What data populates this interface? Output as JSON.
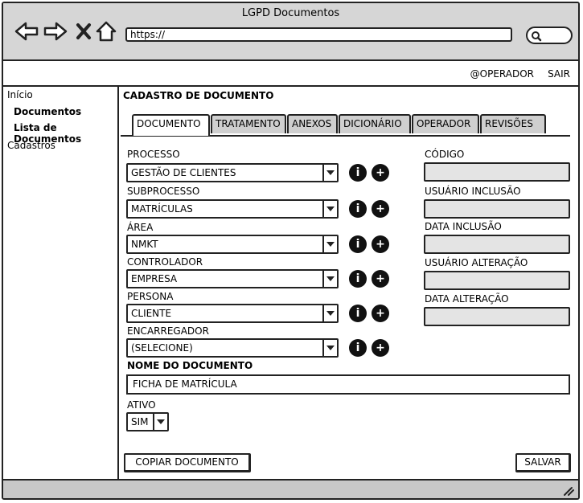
{
  "window": {
    "title": "LGPD Documentos"
  },
  "browser": {
    "url": "https://"
  },
  "userbar": {
    "operator": "@OPERADOR",
    "logout": "SAIR"
  },
  "sidebar": {
    "home": "Início",
    "documents": "Documentos",
    "document_list": "Lista de Documentos",
    "registers": "Cadastros"
  },
  "form": {
    "title": "CADASTRO DE DOCUMENTO",
    "tabs": [
      "DOCUMENTO",
      "TRATAMENTO",
      "ANEXOS",
      "DICIONÁRIO",
      "OPERADOR",
      "REVISÕES"
    ],
    "fields": [
      {
        "label": "PROCESSO",
        "value": "GESTÃO DE CLIENTES"
      },
      {
        "label": "SUBPROCESSO",
        "value": "MATRÍCULAS"
      },
      {
        "label": "ÁREA",
        "value": "NMKT"
      },
      {
        "label": "CONTROLADOR",
        "value": "EMPRESA"
      },
      {
        "label": "PERSONA",
        "value": "CLIENTE"
      },
      {
        "label": "ENCARREGADOR",
        "value": "(SELECIONE)"
      }
    ],
    "info_glyph": "i",
    "add_glyph": "+",
    "right_fields": [
      "CÓDIGO",
      "USUÁRIO INCLUSÃO",
      "DATA INCLUSÃO",
      "USUÁRIO ALTERAÇÃO",
      "DATA ALTERAÇÃO"
    ],
    "doc_name_label": "NOME DO DOCUMENTO",
    "doc_name_value": "FICHA DE MATRÍCULA",
    "active_label": "ATIVO",
    "active_value": "SIM",
    "copy_button": "COPIAR DOCUMENTO",
    "save_button": "SALVAR"
  }
}
